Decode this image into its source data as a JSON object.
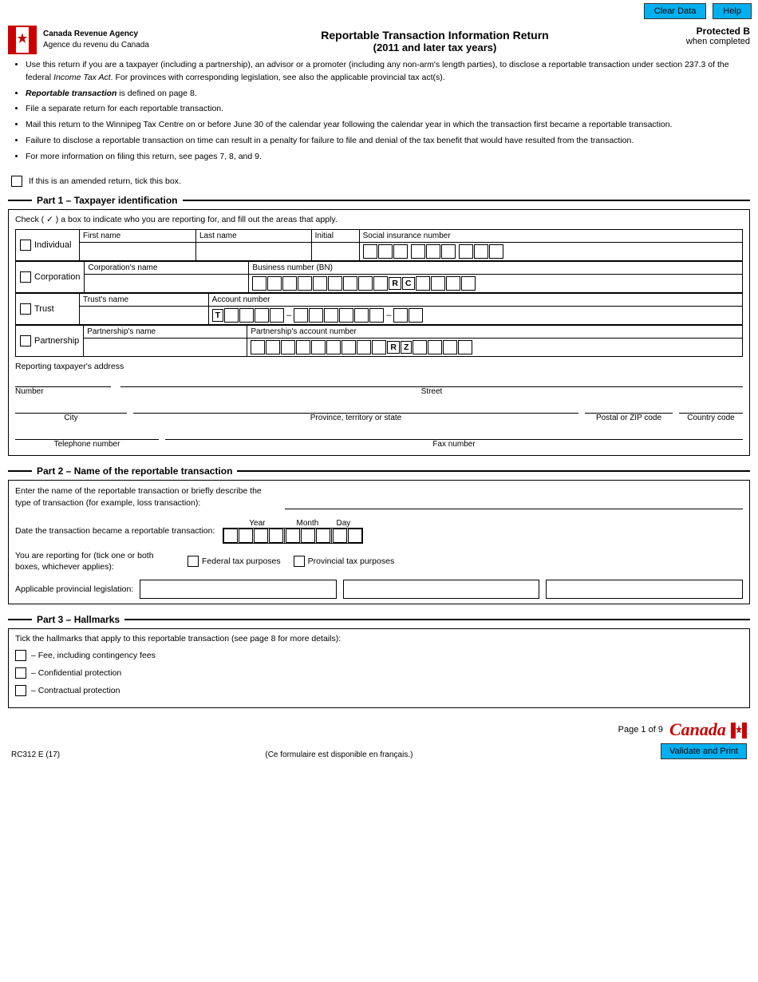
{
  "topbar": {
    "clear_data": "Clear Data",
    "help": "Help"
  },
  "header": {
    "agency_en": "Canada Revenue Agency",
    "agency_fr": "Agence du revenu du Canada",
    "title_line1": "Reportable Transaction Information Return",
    "title_line2": "(2011 and later tax years)",
    "protected_label": "Protected B",
    "protected_sub": "when completed"
  },
  "instructions": [
    "Use this return if you are a taxpayer (including a partnership), an advisor or a promoter (including any non-arm's length parties), to disclose a reportable transaction under section 237.3 of the federal Income Tax Act. For provinces with corresponding legislation, see also the applicable provincial tax act(s).",
    "Reportable transaction is defined on page 8.",
    "File a separate return for each reportable transaction.",
    "Mail this return to the Winnipeg Tax Centre on or before June 30 of the calendar year following the calendar year in which the transaction first became a reportable transaction.",
    "Failure to disclose a reportable transaction on time can result in a penalty for failure to file and denial of the tax benefit that would have resulted from the transaction.",
    "For more information on filing this return, see pages 7, 8, and 9."
  ],
  "amended_label": "If this is an amended return, tick this box.",
  "part1": {
    "title": "Part 1 – Taxpayer identification",
    "check_instruction": "Check ( ✓ ) a box to indicate who you are reporting for, and fill out the areas that apply.",
    "rows": [
      {
        "label": "Individual",
        "col1_header": "First name",
        "col2_header": "Last name",
        "col3_header": "Initial",
        "col4_header": "Social insurance number"
      },
      {
        "label": "Corporation",
        "col1_header": "Corporation's name",
        "col2_header": "Business number (BN)",
        "suffix": "R C"
      },
      {
        "label": "Trust",
        "col1_header": "Trust's name",
        "col2_header": "Account number",
        "prefix": "T",
        "separator": "–"
      },
      {
        "label": "Partnership",
        "col1_header": "Partnership's name",
        "col2_header": "Partnership's account number",
        "suffix": "R Z"
      }
    ],
    "address_label": "Reporting taxpayer's address",
    "number_label": "Number",
    "street_label": "Street",
    "city_label": "City",
    "province_label": "Province, territory or state",
    "postal_label": "Postal or ZIP code",
    "country_label": "Country code",
    "telephone_label": "Telephone number",
    "fax_label": "Fax number"
  },
  "part2": {
    "title": "Part 2 – Name of the reportable transaction",
    "enter_text": "Enter the name of the reportable transaction or briefly describe the type of transaction (for example, loss transaction):",
    "date_label": "Date the transaction became a reportable transaction:",
    "date_headers": [
      "Year",
      "Month",
      "Day"
    ],
    "reporting_for_label": "You are reporting for (tick one or both boxes, whichever applies):",
    "federal_label": "Federal tax purposes",
    "provincial_label": "Provincial tax purposes",
    "applicable_label": "Applicable provincial legislation:"
  },
  "part3": {
    "title": "Part 3 – Hallmarks",
    "instruction": "Tick the hallmarks that apply to this reportable transaction (see page 8 for more details):",
    "hallmarks": [
      "– Fee, including contingency fees",
      "– Confidential protection",
      "– Contractual protection"
    ]
  },
  "footer": {
    "form_code": "RC312 E (17)",
    "french_note": "(Ce formulaire est disponible en français.)",
    "page_info": "Page 1 of 9",
    "canada_logo": "Canada",
    "validate_btn": "Validate and Print"
  }
}
